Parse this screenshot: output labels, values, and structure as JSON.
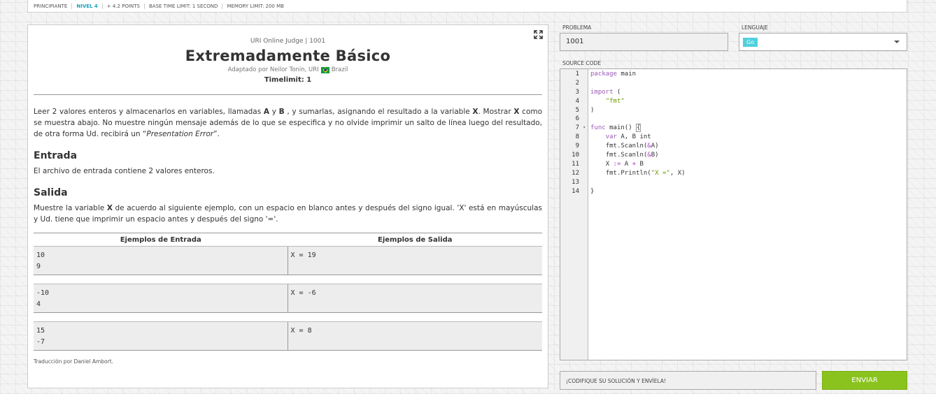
{
  "infobar": {
    "category": "PRINCIPIANTE",
    "level": "NIVEL 4",
    "points": "+ 4.2 POINTS",
    "time_limit": "BASE TIME LIMIT: 1 SECOND",
    "memory_limit": "MEMORY LIMIT: 200 MB"
  },
  "problem": {
    "origin": "URI Online Judge | 1001",
    "title": "Extremadamente Básico",
    "author": "Adaptado por Neilor Tonin, URI",
    "country": "Brazil",
    "timelimit": "Timelimit: 1",
    "desc_1": "Leer 2 valores enteros y almacenarlos en variables, llamadas ",
    "var_a": "A",
    "desc_2": " y ",
    "var_b": "B",
    "desc_3": " , y sumarlas, asignando el resultado a la variable ",
    "var_x": "X",
    "desc_4": ". Mostrar ",
    "var_x2": "X",
    "desc_5": " como se muestra abajo. No muestre ningún mensaje además de lo que se especifica y no olvide imprimir un salto de línea luego del resultado, de otra forma Ud. recibirá un “",
    "desc_error": "Presentation Error",
    "desc_6": "”.",
    "input_heading": "Entrada",
    "input_text": "El archivo de entrada contiene 2 valores enteros.",
    "output_heading": "Salida",
    "output_1": "Muestre la variable ",
    "output_var": "X",
    "output_2": " de acuerdo al siguiente ejemplo, con un espacio en blanco antes y después del signo igual. 'X' está en mayúsculas y Ud. tiene que imprimir un espacio antes y después del signo '='.",
    "examples_input_header": "Ejemplos de Entrada",
    "examples_output_header": "Ejemplos de Salida",
    "examples": [
      {
        "input": "10\n9",
        "output": "X = 19"
      },
      {
        "input": "-10\n4",
        "output": "X = -6"
      },
      {
        "input": "15\n-7",
        "output": "X = 8"
      }
    ],
    "translation": "Traducción por Daniel Ambort."
  },
  "form": {
    "problem_label": "PROBLEMA",
    "problem_value": "1001",
    "language_label": "LENGUAJE",
    "language_value": "Go",
    "source_label": "SOURCE CODE",
    "hint": "¡CODIFIQUE SU SOLUCIÓN Y ENVÍELA!",
    "submit": "ENVIAR"
  },
  "editor": {
    "lines": [
      "1",
      "2",
      "3",
      "4",
      "5",
      "6",
      "7",
      "8",
      "9",
      "10",
      "11",
      "12",
      "13",
      "14"
    ],
    "code": {
      "l1_kw": "package",
      "l1_rest": " main",
      "l3_kw": "import",
      "l3_rest": " (",
      "l4_str": "\"fmt\"",
      "l5": ")",
      "l7_kw": "func",
      "l7_rest": " main() ",
      "l7_brace": "{",
      "l8_kw": "var",
      "l8_rest": " A, B int",
      "l9_a": "fmt.Scanln(",
      "l9_op": "&",
      "l9_b": "A)",
      "l10_a": "fmt.Scanln(",
      "l10_op": "&",
      "l10_b": "B)",
      "l11_a": "X ",
      "l11_op": ":=",
      "l11_b": " A ",
      "l11_op2": "+",
      "l11_c": " B",
      "l12_a": "fmt.Println(",
      "l12_str": "\"X =\"",
      "l12_b": ", X)",
      "l14": "}"
    }
  }
}
